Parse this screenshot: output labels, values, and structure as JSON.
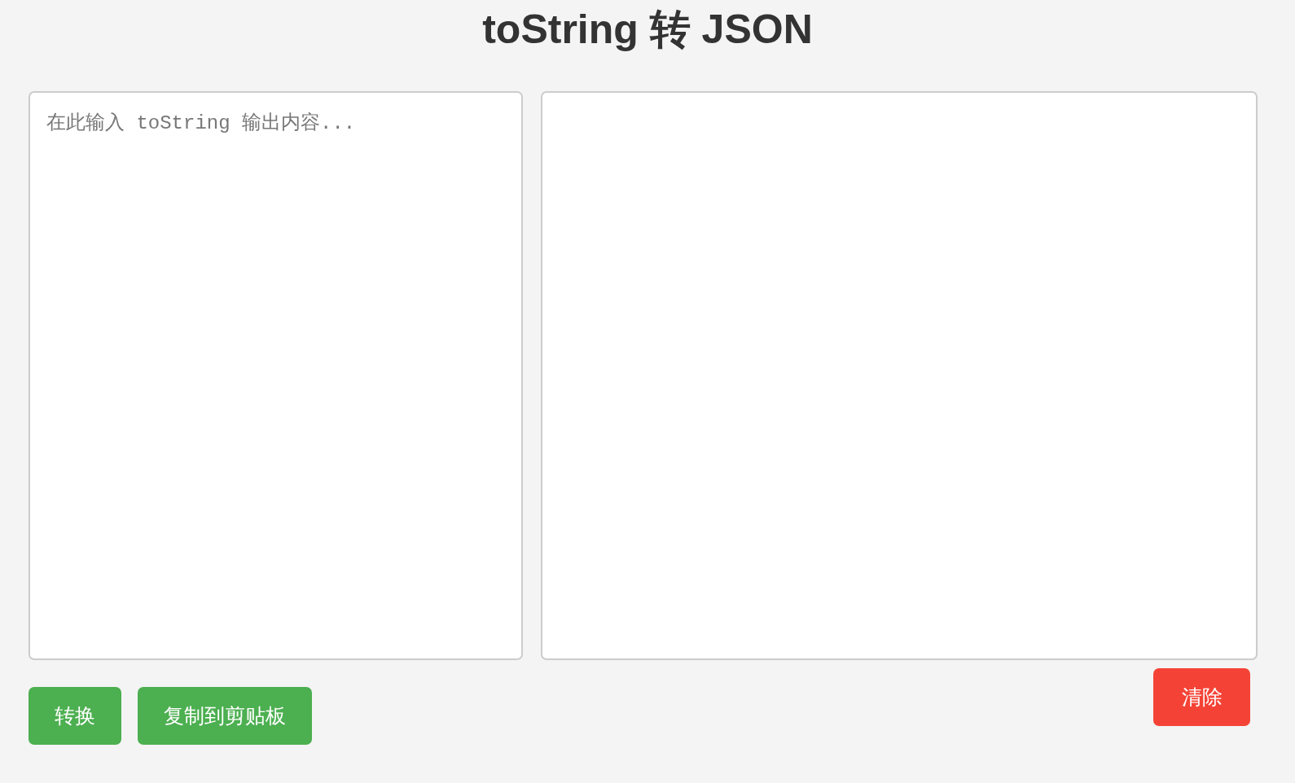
{
  "title": "toString 转 JSON",
  "input": {
    "placeholder": "在此输入 toString 输出内容..."
  },
  "actions": [
    {
      "label": "转换"
    },
    {
      "label": "复制到剪贴板"
    }
  ],
  "clear_button": {
    "label": "清除"
  }
}
